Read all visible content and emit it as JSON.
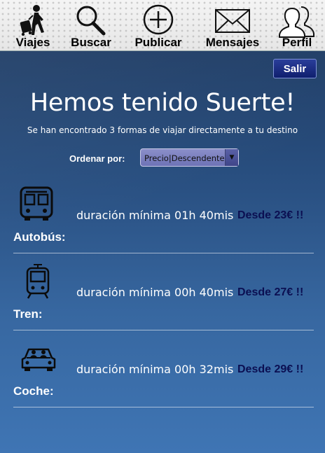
{
  "nav": {
    "items": [
      {
        "label": "Viajes",
        "icon": "traveler-luggage-icon"
      },
      {
        "label": "Buscar",
        "icon": "magnifier-icon"
      },
      {
        "label": "Publicar",
        "icon": "plus-circle-icon"
      },
      {
        "label": "Mensajes",
        "icon": "envelope-icon"
      },
      {
        "label": "Perfil",
        "icon": "users-icon"
      }
    ]
  },
  "header": {
    "logout_label": "Salir",
    "title": "Hemos tenido Suerte!",
    "subtitle": "Se han encontrado 3 formas de viajar directamente a tu destino"
  },
  "sort": {
    "label": "Ordenar por:",
    "selected": "Precio|Descendente",
    "arrow": "▼"
  },
  "results": [
    {
      "mode": "Autobús:",
      "icon": "bus-icon",
      "duration": "duración mínima 01h 40mis",
      "price": "Desde 23€ !!"
    },
    {
      "mode": "Tren:",
      "icon": "train-icon",
      "duration": "duración mínima 00h 40mis",
      "price": "Desde 27€ !!"
    },
    {
      "mode": "Coche:",
      "icon": "car-icon",
      "duration": "duración mínima 00h 32mis",
      "price": "Desde 29€ !!"
    }
  ],
  "colors": {
    "price_text": "#0b0f52",
    "logout_button": "#1b2b85",
    "sort_select": "#7a7fbf"
  }
}
